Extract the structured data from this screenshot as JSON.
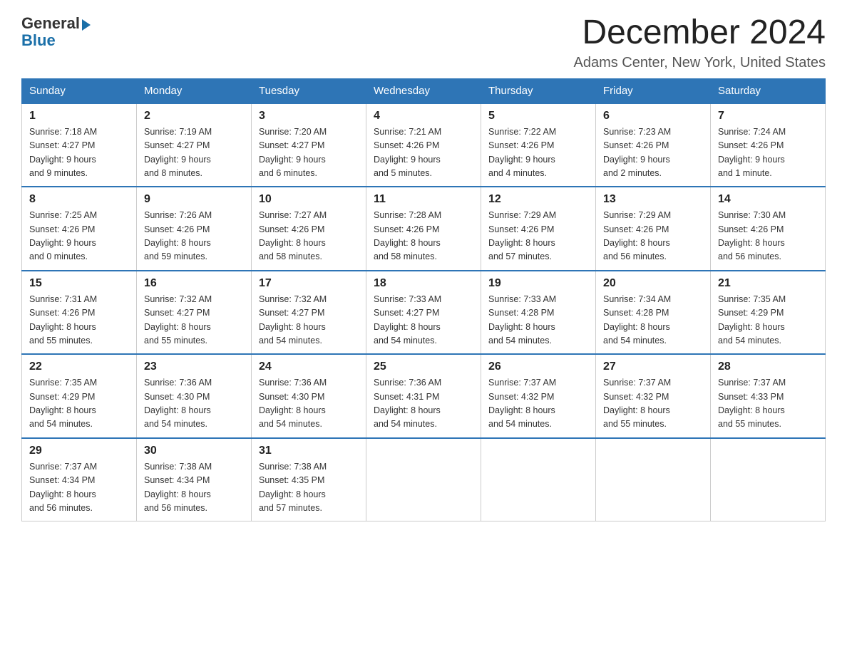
{
  "header": {
    "logo_general": "General",
    "logo_blue": "Blue",
    "month_title": "December 2024",
    "location": "Adams Center, New York, United States"
  },
  "days_of_week": [
    "Sunday",
    "Monday",
    "Tuesday",
    "Wednesday",
    "Thursday",
    "Friday",
    "Saturday"
  ],
  "weeks": [
    [
      {
        "day": "1",
        "info": "Sunrise: 7:18 AM\nSunset: 4:27 PM\nDaylight: 9 hours\nand 9 minutes."
      },
      {
        "day": "2",
        "info": "Sunrise: 7:19 AM\nSunset: 4:27 PM\nDaylight: 9 hours\nand 8 minutes."
      },
      {
        "day": "3",
        "info": "Sunrise: 7:20 AM\nSunset: 4:27 PM\nDaylight: 9 hours\nand 6 minutes."
      },
      {
        "day": "4",
        "info": "Sunrise: 7:21 AM\nSunset: 4:26 PM\nDaylight: 9 hours\nand 5 minutes."
      },
      {
        "day": "5",
        "info": "Sunrise: 7:22 AM\nSunset: 4:26 PM\nDaylight: 9 hours\nand 4 minutes."
      },
      {
        "day": "6",
        "info": "Sunrise: 7:23 AM\nSunset: 4:26 PM\nDaylight: 9 hours\nand 2 minutes."
      },
      {
        "day": "7",
        "info": "Sunrise: 7:24 AM\nSunset: 4:26 PM\nDaylight: 9 hours\nand 1 minute."
      }
    ],
    [
      {
        "day": "8",
        "info": "Sunrise: 7:25 AM\nSunset: 4:26 PM\nDaylight: 9 hours\nand 0 minutes."
      },
      {
        "day": "9",
        "info": "Sunrise: 7:26 AM\nSunset: 4:26 PM\nDaylight: 8 hours\nand 59 minutes."
      },
      {
        "day": "10",
        "info": "Sunrise: 7:27 AM\nSunset: 4:26 PM\nDaylight: 8 hours\nand 58 minutes."
      },
      {
        "day": "11",
        "info": "Sunrise: 7:28 AM\nSunset: 4:26 PM\nDaylight: 8 hours\nand 58 minutes."
      },
      {
        "day": "12",
        "info": "Sunrise: 7:29 AM\nSunset: 4:26 PM\nDaylight: 8 hours\nand 57 minutes."
      },
      {
        "day": "13",
        "info": "Sunrise: 7:29 AM\nSunset: 4:26 PM\nDaylight: 8 hours\nand 56 minutes."
      },
      {
        "day": "14",
        "info": "Sunrise: 7:30 AM\nSunset: 4:26 PM\nDaylight: 8 hours\nand 56 minutes."
      }
    ],
    [
      {
        "day": "15",
        "info": "Sunrise: 7:31 AM\nSunset: 4:26 PM\nDaylight: 8 hours\nand 55 minutes."
      },
      {
        "day": "16",
        "info": "Sunrise: 7:32 AM\nSunset: 4:27 PM\nDaylight: 8 hours\nand 55 minutes."
      },
      {
        "day": "17",
        "info": "Sunrise: 7:32 AM\nSunset: 4:27 PM\nDaylight: 8 hours\nand 54 minutes."
      },
      {
        "day": "18",
        "info": "Sunrise: 7:33 AM\nSunset: 4:27 PM\nDaylight: 8 hours\nand 54 minutes."
      },
      {
        "day": "19",
        "info": "Sunrise: 7:33 AM\nSunset: 4:28 PM\nDaylight: 8 hours\nand 54 minutes."
      },
      {
        "day": "20",
        "info": "Sunrise: 7:34 AM\nSunset: 4:28 PM\nDaylight: 8 hours\nand 54 minutes."
      },
      {
        "day": "21",
        "info": "Sunrise: 7:35 AM\nSunset: 4:29 PM\nDaylight: 8 hours\nand 54 minutes."
      }
    ],
    [
      {
        "day": "22",
        "info": "Sunrise: 7:35 AM\nSunset: 4:29 PM\nDaylight: 8 hours\nand 54 minutes."
      },
      {
        "day": "23",
        "info": "Sunrise: 7:36 AM\nSunset: 4:30 PM\nDaylight: 8 hours\nand 54 minutes."
      },
      {
        "day": "24",
        "info": "Sunrise: 7:36 AM\nSunset: 4:30 PM\nDaylight: 8 hours\nand 54 minutes."
      },
      {
        "day": "25",
        "info": "Sunrise: 7:36 AM\nSunset: 4:31 PM\nDaylight: 8 hours\nand 54 minutes."
      },
      {
        "day": "26",
        "info": "Sunrise: 7:37 AM\nSunset: 4:32 PM\nDaylight: 8 hours\nand 54 minutes."
      },
      {
        "day": "27",
        "info": "Sunrise: 7:37 AM\nSunset: 4:32 PM\nDaylight: 8 hours\nand 55 minutes."
      },
      {
        "day": "28",
        "info": "Sunrise: 7:37 AM\nSunset: 4:33 PM\nDaylight: 8 hours\nand 55 minutes."
      }
    ],
    [
      {
        "day": "29",
        "info": "Sunrise: 7:37 AM\nSunset: 4:34 PM\nDaylight: 8 hours\nand 56 minutes."
      },
      {
        "day": "30",
        "info": "Sunrise: 7:38 AM\nSunset: 4:34 PM\nDaylight: 8 hours\nand 56 minutes."
      },
      {
        "day": "31",
        "info": "Sunrise: 7:38 AM\nSunset: 4:35 PM\nDaylight: 8 hours\nand 57 minutes."
      },
      {
        "day": "",
        "info": ""
      },
      {
        "day": "",
        "info": ""
      },
      {
        "day": "",
        "info": ""
      },
      {
        "day": "",
        "info": ""
      }
    ]
  ]
}
